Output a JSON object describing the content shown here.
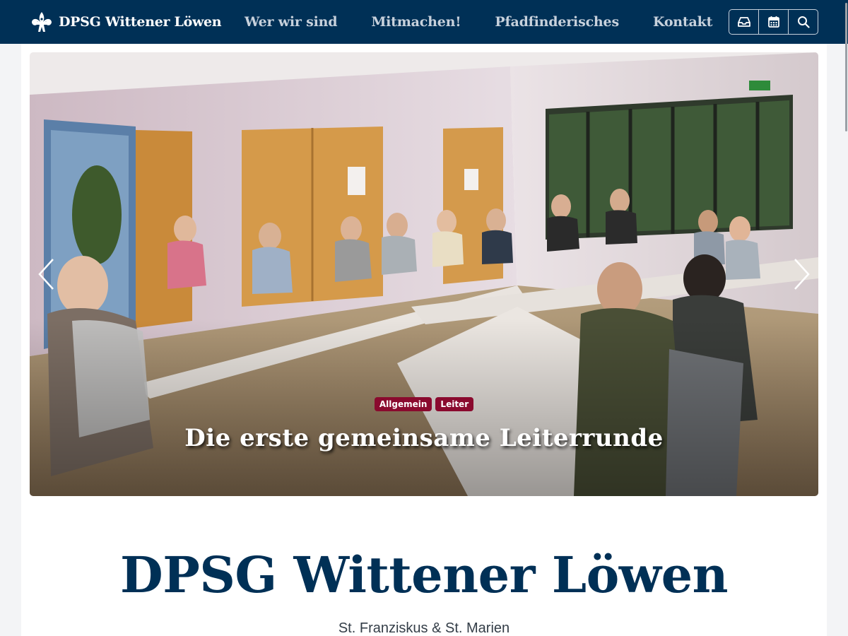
{
  "navbar": {
    "brand_name": "DPSG Wittener Löwen",
    "brand_logo": "lily-logo-icon",
    "links": [
      {
        "label": "Wer wir sind"
      },
      {
        "label": "Mitmachen!"
      },
      {
        "label": "Pfadfinderisches"
      },
      {
        "label": "Kontakt"
      }
    ],
    "icons": [
      "inbox-icon",
      "calendar-icon",
      "search-icon"
    ]
  },
  "carousel": {
    "tags": [
      "Allgemein",
      "Leiter"
    ],
    "slide_title": "Die erste gemeinsame Leiterrunde",
    "prev_icon": "chevron-left-icon",
    "next_icon": "chevron-right-icon"
  },
  "header": {
    "title": "DPSG Wittener Löwen",
    "subtitle": "St. Franziskus & St. Marien"
  },
  "colors": {
    "navbar": "#003056",
    "tag": "#8a0a2e",
    "title": "#003056"
  }
}
